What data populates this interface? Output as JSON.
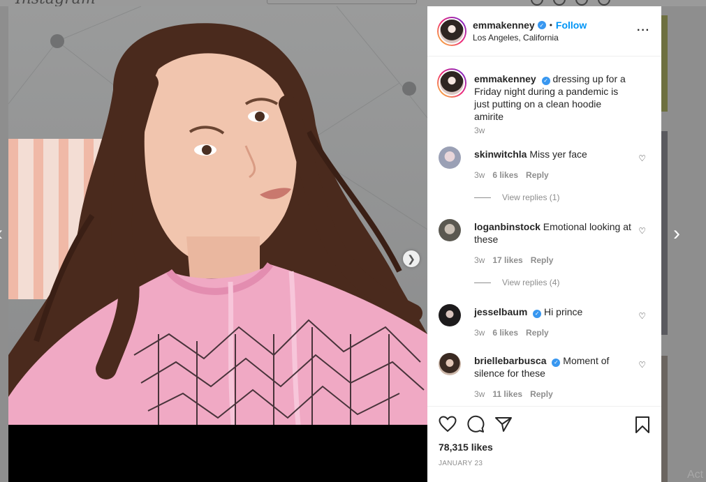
{
  "background": {
    "logo": "Instagram",
    "activate_text": "Act"
  },
  "post": {
    "author": "emmakenney",
    "verified": true,
    "follow_label": "Follow",
    "location": "Los Angeles, California",
    "caption": "dressing up for a Friday night during a pandemic is just putting on a clean hoodie amirite",
    "caption_time": "3w",
    "likes": "78,315 likes",
    "date": "JANUARY 23"
  },
  "comments": [
    {
      "user": "skinwitchla",
      "verified": false,
      "text": "Miss yer face",
      "time": "3w",
      "likes": "6 likes",
      "reply_label": "Reply",
      "view_replies": "View replies (1)"
    },
    {
      "user": "loganbinstock",
      "verified": false,
      "text": "Emotional looking at these",
      "time": "3w",
      "likes": "17 likes",
      "reply_label": "Reply",
      "view_replies": "View replies (4)"
    },
    {
      "user": "jesselbaum",
      "verified": true,
      "text": "Hi prince",
      "time": "3w",
      "likes": "6 likes",
      "reply_label": "Reply"
    },
    {
      "user": "briellebarbusca",
      "verified": true,
      "text": "Moment of silence for these",
      "time": "3w",
      "likes": "11 likes",
      "reply_label": "Reply"
    }
  ],
  "icons": {
    "more": "more-options-icon",
    "like": "heart-icon",
    "comment": "comment-icon",
    "share": "share-icon",
    "save": "bookmark-icon",
    "next": "chevron-right-icon",
    "verified": "verified-badge-icon"
  },
  "colors": {
    "link_blue": "#0095f6",
    "verified_blue": "#3897f0",
    "muted_text": "#8e8e8e",
    "hoodie_pink": "#f0a9c4"
  }
}
